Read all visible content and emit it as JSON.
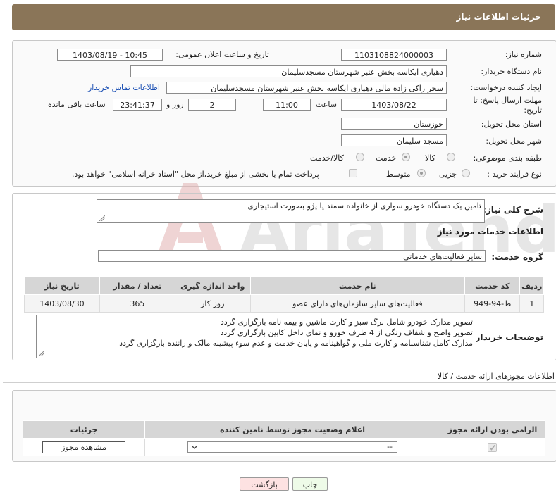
{
  "header": {
    "title": "جزئیات اطلاعات نیاز"
  },
  "info": {
    "need_number_label": "شماره نیاز:",
    "need_number": "1103108824000003",
    "announce_label": "تاریخ و ساعت اعلان عمومی:",
    "announce_value": "1403/08/19 - 10:45",
    "buyer_label": "نام دستگاه خریدار:",
    "buyer_value": "دهیاری ایکاسه بخش عنبر شهرستان مسجدسلیمان",
    "creator_label": "ایجاد کننده درخواست:",
    "creator_value": "سحر راکی زاده مالی دهیاری ایکاسه بخش عنبر شهرستان مسجدسلیمان",
    "contact_link": "اطلاعات تماس خریدار",
    "deadline_label": "مهلت ارسال پاسخ: تا تاریخ:",
    "deadline_date": "1403/08/22",
    "time_label": "ساعت",
    "deadline_time": "11:00",
    "days_value": "2",
    "days_label": "روز و",
    "remaining_value": "23:41:37",
    "remaining_label": "ساعت باقی مانده",
    "province_label": "استان محل تحویل:",
    "province_value": "خوزستان",
    "city_label": "شهر محل تحویل:",
    "city_value": "مسجد سلیمان",
    "category_label": "طبقه بندی موضوعی:",
    "category_options": [
      "کالا",
      "خدمت",
      "کالا/خدمت"
    ],
    "process_label": "نوع فرآیند خرید :",
    "process_options": [
      "جزیی",
      "متوسط"
    ],
    "payment_note": "پرداخت تمام یا بخشی از مبلغ خرید،از محل \"اسناد خزانه اسلامی\" خواهد بود."
  },
  "details": {
    "summary_label": "شرح کلی نیاز:",
    "summary_value": "تامین یک دستگاه خودرو سواری  از خانواده سمند یا پژو بصورت استیجاری",
    "services_title": "اطلاعات خدمات مورد نیاز",
    "group_label": "گروه خدمت:",
    "group_value": "سایر فعالیت‌های خدماتی",
    "table": {
      "headers": [
        "ردیف",
        "کد خدمت",
        "نام خدمت",
        "واحد اندازه گیری",
        "تعداد / مقدار",
        "تاریخ نیاز"
      ],
      "rows": [
        [
          "1",
          "ط-94-949",
          "فعالیت‌های سایر سازمان‌های دارای عضو",
          "روز کار",
          "365",
          "1403/08/30"
        ]
      ]
    },
    "buyer_notes_label": "توضیحات خریدار:",
    "buyer_notes": [
      "تصویر مدارک خودرو شامل برگ سبز و کارت ماشین و بیمه نامه بارگزاری گردد",
      "تصویر واضح و شفاف رنگی از 4 طرف خورو و نمای داخل کابین بارگزاری گردد",
      "مدارک کامل شناسنامه و کارت ملی و گواهینامه و پایان خدمت و عدم سوء پیشینه مالک و راننده بارگزاری گردد"
    ]
  },
  "permits": {
    "title": "اطلاعات مجوزهای ارائه خدمت / کالا",
    "headers": [
      "الزامی بودن ارائه مجوز",
      "اعلام وضعیت مجوز توسط نامین کننده",
      "جزئیات"
    ],
    "select_value": "--",
    "view_button": "مشاهده مجوز"
  },
  "footer": {
    "print_button": "چاپ",
    "back_button": "بازگشت"
  },
  "watermark": {
    "text": "AriaTender.neT"
  },
  "colors": {
    "header_bg": "#8a7558",
    "link": "#1a4fb4",
    "back_bg": "#fde2e2",
    "print_bg": "#eefbe8"
  }
}
